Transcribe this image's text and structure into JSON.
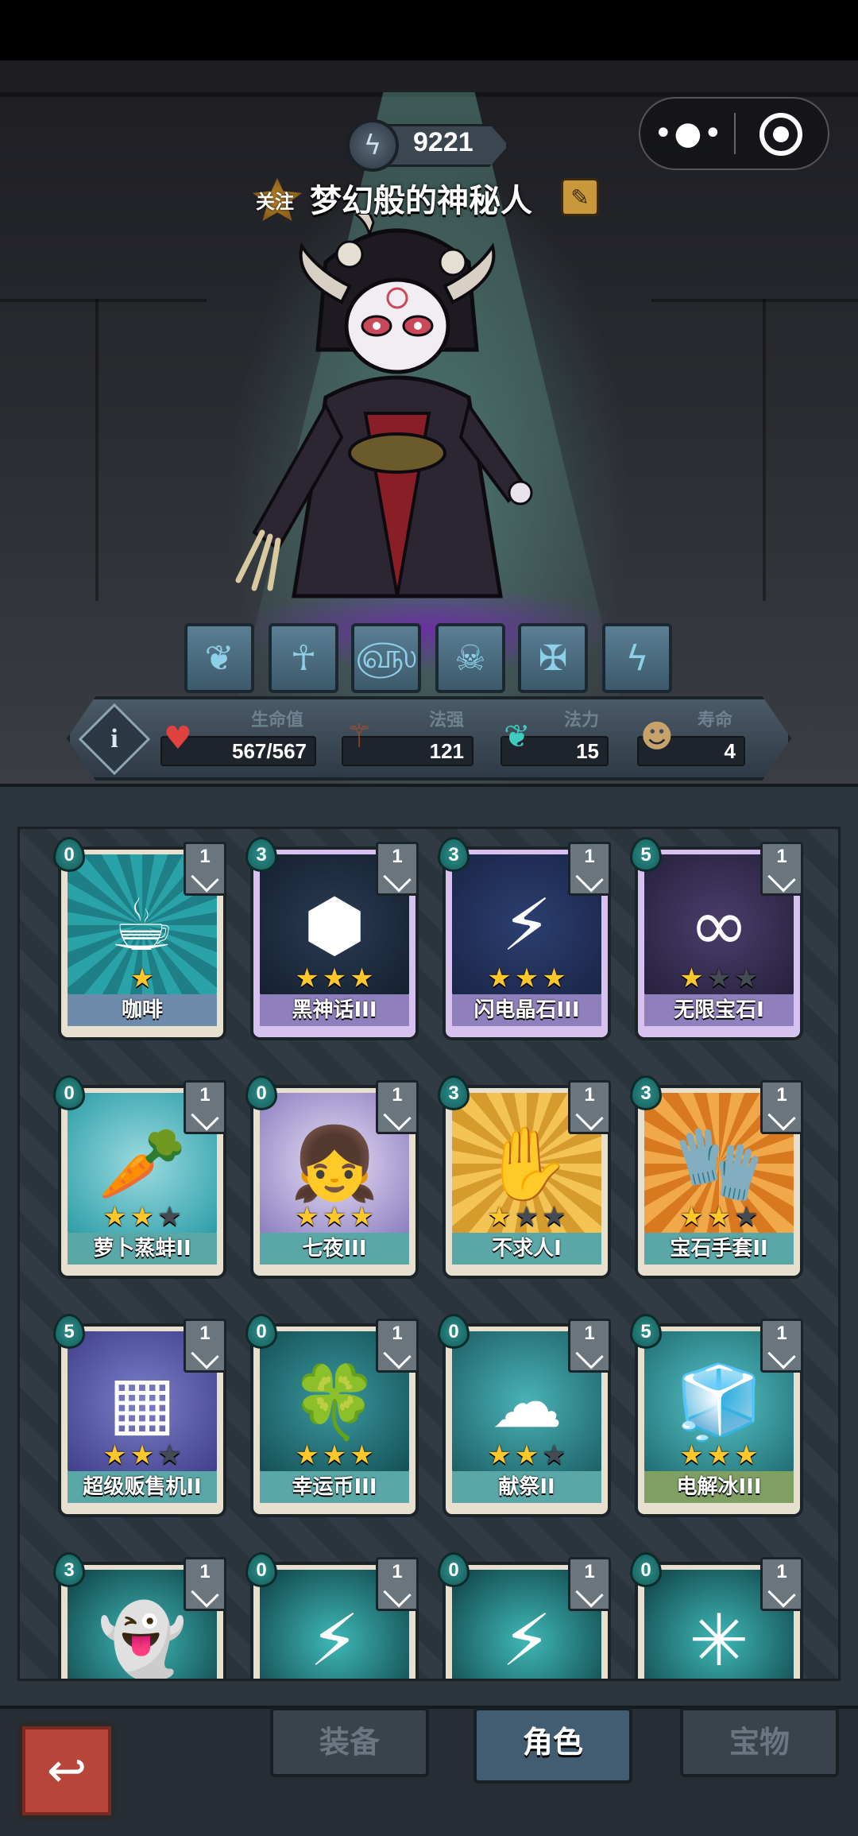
{
  "header": {
    "coin_value": "9221",
    "follow_label": "关注",
    "player_name": "梦幻般的神秘人"
  },
  "stats": {
    "hp": {
      "label": "生命值",
      "value": "567/567",
      "icon": "heart-icon"
    },
    "power": {
      "label": "法强",
      "value": "121",
      "icon": "staff-icon"
    },
    "mana": {
      "label": "法力",
      "value": "15",
      "icon": "flame-icon"
    },
    "life": {
      "label": "寿命",
      "value": "4",
      "icon": "face-icon"
    }
  },
  "skills": [
    "sprout-icon",
    "figure-icon",
    "swirl-icon",
    "skull-icon",
    "cross-icon",
    "bolt-icon"
  ],
  "cards": [
    {
      "name": "咖啡",
      "cost": "0",
      "count": "1",
      "stars": 1,
      "max_stars": 1,
      "frame": "blue",
      "art": "a-coffee",
      "icon": "☕"
    },
    {
      "name": "黑神话III",
      "cost": "3",
      "count": "1",
      "stars": 3,
      "max_stars": 3,
      "frame": "purple",
      "art": "a-stone",
      "icon": "⬢"
    },
    {
      "name": "闪电晶石III",
      "cost": "3",
      "count": "1",
      "stars": 3,
      "max_stars": 3,
      "frame": "purple",
      "art": "a-bolt",
      "icon": "⚡"
    },
    {
      "name": "无限宝石I",
      "cost": "5",
      "count": "1",
      "stars": 1,
      "max_stars": 3,
      "frame": "purple",
      "art": "a-gem",
      "icon": "∞"
    },
    {
      "name": "萝卜蒸蚌II",
      "cost": "0",
      "count": "1",
      "stars": 2,
      "max_stars": 3,
      "frame": "teal",
      "art": "a-clam",
      "icon": "🥕"
    },
    {
      "name": "七夜III",
      "cost": "0",
      "count": "1",
      "stars": 3,
      "max_stars": 3,
      "frame": "teal",
      "art": "a-girl",
      "icon": "👧"
    },
    {
      "name": "不求人I",
      "cost": "3",
      "count": "1",
      "stars": 1,
      "max_stars": 3,
      "frame": "teal",
      "art": "a-beg",
      "icon": "✋"
    },
    {
      "name": "宝石手套II",
      "cost": "3",
      "count": "1",
      "stars": 2,
      "max_stars": 3,
      "frame": "teal",
      "art": "a-glove",
      "icon": "🧤"
    },
    {
      "name": "超级贩售机II",
      "cost": "5",
      "count": "1",
      "stars": 2,
      "max_stars": 3,
      "frame": "teal",
      "art": "a-vend",
      "icon": "▦"
    },
    {
      "name": "幸运币III",
      "cost": "0",
      "count": "1",
      "stars": 3,
      "max_stars": 3,
      "frame": "teal",
      "art": "a-coin",
      "icon": "🍀"
    },
    {
      "name": "献祭II",
      "cost": "0",
      "count": "1",
      "stars": 2,
      "max_stars": 3,
      "frame": "teal",
      "art": "a-sac",
      "icon": "☁"
    },
    {
      "name": "电解冰III",
      "cost": "5",
      "count": "1",
      "stars": 3,
      "max_stars": 3,
      "frame": "green",
      "art": "a-ice",
      "icon": "🧊"
    },
    {
      "name": "",
      "cost": "3",
      "count": "1",
      "stars": 0,
      "max_stars": 0,
      "frame": "teal",
      "art": "a-dark",
      "icon": "👻"
    },
    {
      "name": "",
      "cost": "0",
      "count": "1",
      "stars": 0,
      "max_stars": 0,
      "frame": "teal",
      "art": "a-dark",
      "icon": "⚡"
    },
    {
      "name": "",
      "cost": "0",
      "count": "1",
      "stars": 0,
      "max_stars": 0,
      "frame": "teal",
      "art": "a-dark",
      "icon": "⚡"
    },
    {
      "name": "",
      "cost": "0",
      "count": "1",
      "stars": 0,
      "max_stars": 0,
      "frame": "teal",
      "art": "a-dark",
      "icon": "✳"
    }
  ],
  "nav": {
    "tabs": [
      {
        "label": "装备",
        "active": false
      },
      {
        "label": "角色",
        "active": true
      },
      {
        "label": "宝物",
        "active": false
      }
    ]
  }
}
